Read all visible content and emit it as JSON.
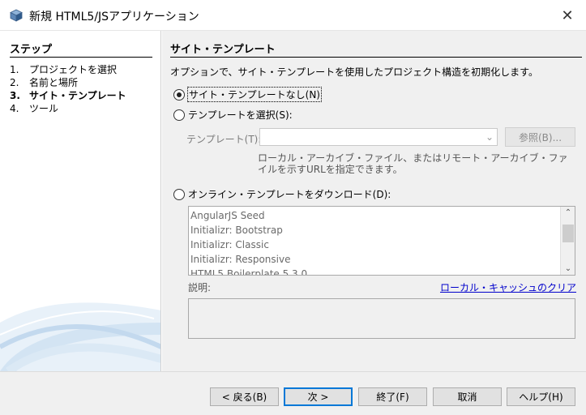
{
  "window": {
    "title": "新規 HTML5/JSアプリケーション",
    "close_glyph": "✕"
  },
  "steps": {
    "heading": "ステップ",
    "items": [
      {
        "num": "1.",
        "label": "プロジェクトを選択"
      },
      {
        "num": "2.",
        "label": "名前と場所"
      },
      {
        "num": "3.",
        "label": "サイト・テンプレート"
      },
      {
        "num": "4.",
        "label": "ツール"
      }
    ],
    "current_index": 2
  },
  "panel": {
    "title": "サイト・テンプレート",
    "description": "オプションで、サイト・テンプレートを使用したプロジェクト構造を初期化します。",
    "options": {
      "no_template": "サイト・テンプレートなし(N)",
      "select_template": "テンプレートを選択(S):",
      "online_template": "オンライン・テンプレートをダウンロード(D):"
    },
    "selected_option": "no_template",
    "template_label": "テンプレート(T):",
    "template_value": "",
    "browse_button": "参照(B)...",
    "hint": "ローカル・アーカイブ・ファイル、またはリモート・アーカイブ・ファイルを示すURLを指定できます。",
    "online_templates": [
      "AngularJS Seed",
      "Initializr: Bootstrap",
      "Initializr: Classic",
      "Initializr: Responsive",
      "HTML5 Boilerplate 5.3.0"
    ],
    "description_label": "説明:",
    "clear_cache_link": "ローカル・キャッシュのクリア",
    "description_text": ""
  },
  "footer": {
    "back": "< 戻る(B)",
    "next": "次 >",
    "finish": "終了(F)",
    "cancel": "取消",
    "help": "ヘルプ(H)"
  },
  "icons": {
    "app": "cube-icon",
    "close": "close-icon",
    "combo": "chevron-down-icon",
    "scroll_up": "chevron-up-icon",
    "scroll_down": "chevron-down-icon"
  },
  "colors": {
    "link": "#0000cc",
    "default_button_border": "#0078d7",
    "panel_background": "#f0f0f0"
  }
}
